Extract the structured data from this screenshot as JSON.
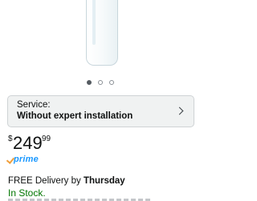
{
  "carousel": {
    "slide_count": 3,
    "active_index": 0
  },
  "service": {
    "label": "Service:",
    "value": "Without expert installation"
  },
  "price": {
    "symbol": "$",
    "whole": "249",
    "fraction": "99"
  },
  "prime": {
    "text": "prime"
  },
  "delivery": {
    "prefix": "FREE Delivery by ",
    "day": "Thursday"
  },
  "stock": {
    "text": "In Stock."
  },
  "colors": {
    "stock_green": "#007600",
    "prime_blue": "#1a98ff",
    "prime_check": "#f19e39"
  }
}
